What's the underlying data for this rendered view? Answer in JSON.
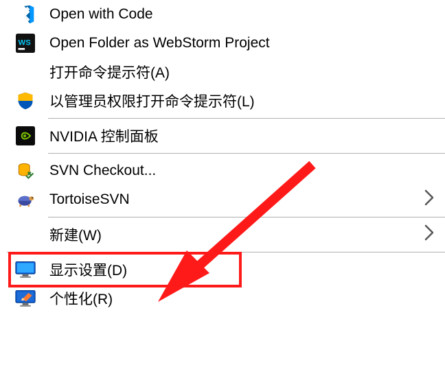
{
  "menu": {
    "items": [
      {
        "key": "open-code",
        "label": "Open with Code",
        "icon": "vscode",
        "submenu": false
      },
      {
        "key": "open-webstorm",
        "label": "Open Folder as WebStorm Project",
        "icon": "webstorm",
        "submenu": false
      },
      {
        "key": "cmd",
        "label": "打开命令提示符(A)",
        "icon": "",
        "submenu": false
      },
      {
        "key": "cmd-admin",
        "label": "以管理员权限打开命令提示符(L)",
        "icon": "shield",
        "submenu": false
      },
      {
        "key": "nvidia",
        "label": "NVIDIA 控制面板",
        "icon": "nvidia",
        "submenu": false
      },
      {
        "key": "svn-checkout",
        "label": "SVN Checkout...",
        "icon": "svn",
        "submenu": false
      },
      {
        "key": "tortoisesvn",
        "label": "TortoiseSVN",
        "icon": "tortoise",
        "submenu": true
      },
      {
        "key": "new",
        "label": "新建(W)",
        "icon": "",
        "submenu": true
      },
      {
        "key": "display",
        "label": "显示设置(D)",
        "icon": "display",
        "submenu": false,
        "highlighted": true
      },
      {
        "key": "personalize",
        "label": "个性化(R)",
        "icon": "personalize",
        "submenu": false
      }
    ]
  },
  "annotation": {
    "highlight_color": "#ff1a1a",
    "arrow_color": "#ff1a1a"
  }
}
